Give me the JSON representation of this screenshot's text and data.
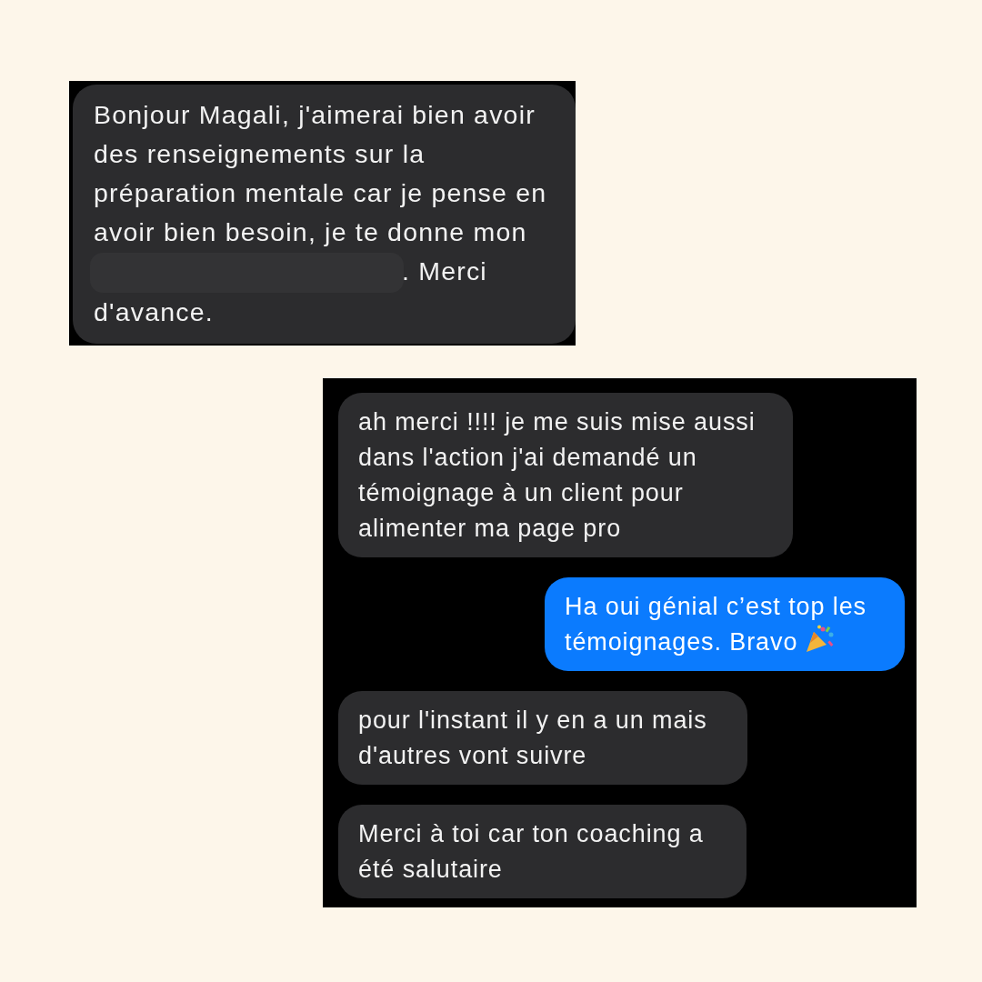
{
  "screenshots": [
    {
      "messages": [
        {
          "kind": "received",
          "text_before": "Bonjour Magali, j'aimerai bien avoir des renseignements sur la préparation mentale car je pense en avoir bien besoin, je te donne mon",
          "redacted": true,
          "text_after": ". Merci d'avance."
        }
      ]
    },
    {
      "messages": [
        {
          "kind": "received",
          "text": "ah merci !!!! je me suis mise aussi dans l'action j'ai demandé un témoignage à un client pour alimenter ma page pro"
        },
        {
          "kind": "sent",
          "text": "Ha oui génial c’est top les témoignages. Bravo",
          "party_icon": true
        },
        {
          "kind": "received",
          "text": "pour l'instant il y en a un mais d'autres vont suivre"
        },
        {
          "kind": "received",
          "text": "Merci à toi car ton coaching a été salutaire"
        }
      ]
    }
  ]
}
